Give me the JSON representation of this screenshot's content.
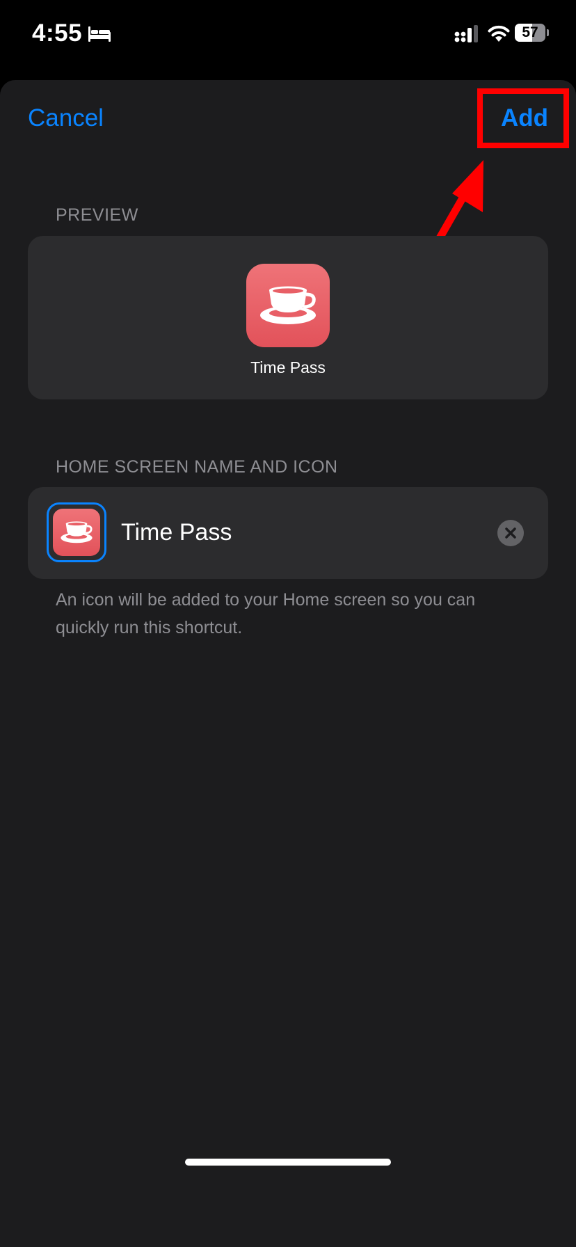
{
  "status_bar": {
    "time": "4:55",
    "battery": "57",
    "battery_level": 0.57,
    "icons": [
      "bed-icon",
      "cellular-signal-icon",
      "wifi-icon",
      "battery-icon"
    ]
  },
  "nav": {
    "cancel_label": "Cancel",
    "add_label": "Add"
  },
  "preview": {
    "header": "PREVIEW",
    "app_name": "Time Pass",
    "icon": "coffee-cup-icon"
  },
  "home_screen": {
    "header": "HOME SCREEN NAME AND ICON",
    "name_value": "Time Pass",
    "icon": "coffee-cup-icon",
    "clear_icon": "clear-x-icon",
    "footer": "An icon will be added to your Home screen so you can quickly run this shortcut."
  },
  "colors": {
    "accent": "#0a84ff",
    "icon_background": "#e85f66",
    "annotation": "#ff0000"
  }
}
